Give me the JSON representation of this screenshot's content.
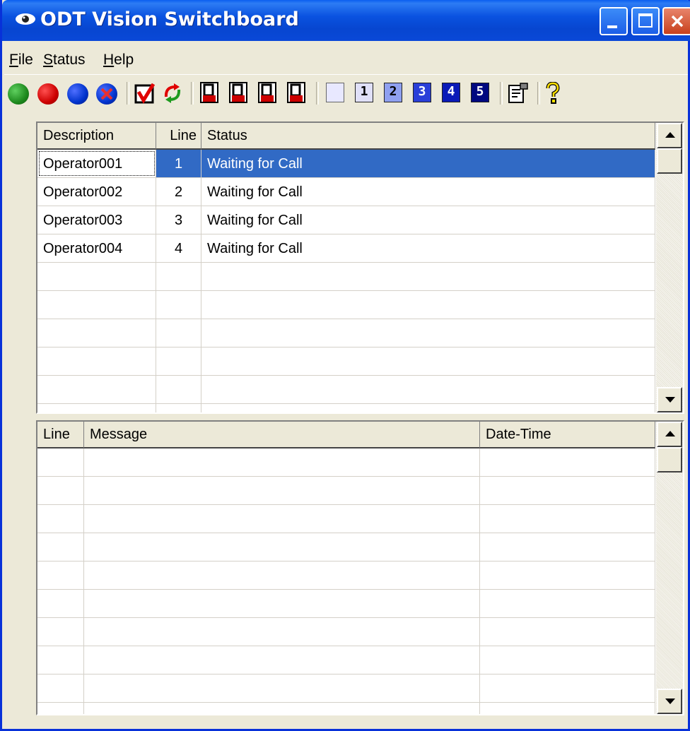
{
  "window": {
    "title": "ODT Vision Switchboard"
  },
  "menu": {
    "file": "File",
    "status": "Status",
    "help": "Help"
  },
  "toolbar": {
    "buttons": [
      {
        "icon": "green-circle-icon",
        "color": "#1e8a1e"
      },
      {
        "icon": "red-circle-icon",
        "color": "#cc0000"
      },
      {
        "icon": "blue-circle-icon",
        "color": "#0033cc"
      },
      {
        "icon": "blue-circle-x-icon",
        "color": "#0033cc"
      },
      {
        "icon": "checkbox-red-check-icon"
      },
      {
        "icon": "refresh-arrows-icon"
      },
      {
        "icon": "off-page-icon-1"
      },
      {
        "icon": "off-page-icon-2"
      },
      {
        "icon": "off-page-icon-3"
      },
      {
        "icon": "off-page-icon-4"
      }
    ],
    "line_buttons": [
      "",
      "1",
      "2",
      "3",
      "4",
      "5"
    ],
    "properties_icon": "properties-icon",
    "help_icon": "help-question-icon"
  },
  "operators_table": {
    "headers": {
      "description": "Description",
      "line": "Line",
      "status": "Status"
    },
    "rows": [
      {
        "description": "Operator001",
        "line": "1",
        "status": "Waiting for Call",
        "selected": true
      },
      {
        "description": "Operator002",
        "line": "2",
        "status": "Waiting for Call"
      },
      {
        "description": "Operator003",
        "line": "3",
        "status": "Waiting for Call"
      },
      {
        "description": "Operator004",
        "line": "4",
        "status": "Waiting for Call"
      }
    ]
  },
  "messages_table": {
    "headers": {
      "line": "Line",
      "message": "Message",
      "datetime": "Date-Time"
    },
    "rows": []
  },
  "colors": {
    "selection": "#316ac5",
    "titlebar": "#0a52e0",
    "face": "#ece9d8"
  }
}
